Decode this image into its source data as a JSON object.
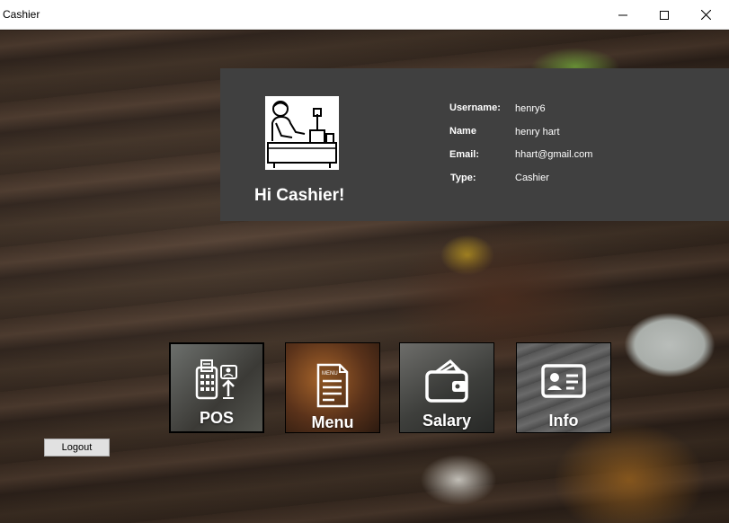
{
  "window": {
    "title": "Cashier"
  },
  "profile": {
    "greeting": "Hi Cashier!",
    "fields": [
      {
        "label": "Username:",
        "value": "henry6"
      },
      {
        "label": "Name",
        "value": "henry hart"
      },
      {
        "label": "Email:",
        "value": "hhart@gmail.com"
      },
      {
        "label": "Type:",
        "value": "Cashier"
      }
    ]
  },
  "tiles": [
    {
      "label": "POS",
      "icon": "pos-terminal-icon"
    },
    {
      "label": "Menu",
      "icon": "menu-document-icon"
    },
    {
      "label": "Salary",
      "icon": "wallet-icon"
    },
    {
      "label": "Info",
      "icon": "id-card-icon"
    }
  ],
  "logout_label": "Logout"
}
